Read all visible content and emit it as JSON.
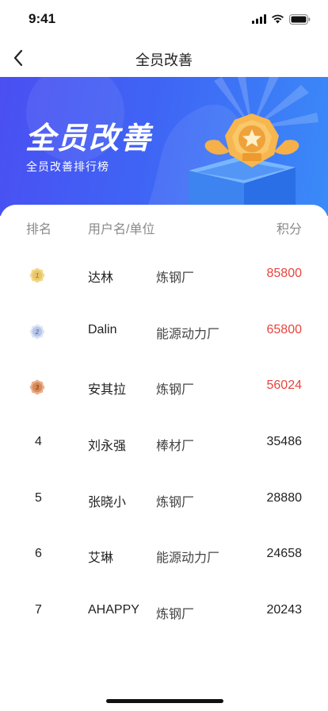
{
  "status_bar": {
    "time": "9:41"
  },
  "nav": {
    "title": "全员改善"
  },
  "banner": {
    "title": "全员改善",
    "subtitle": "全员改善排行榜"
  },
  "table": {
    "headers": {
      "rank": "排名",
      "user": "用户名/单位",
      "points": "积分"
    },
    "rows": [
      {
        "rank": "1",
        "medal": "gold",
        "name": "达林",
        "unit": "炼钢厂",
        "points": "85800"
      },
      {
        "rank": "2",
        "medal": "silver",
        "name": "Dalin",
        "unit": "能源动力厂",
        "points": "65800"
      },
      {
        "rank": "3",
        "medal": "bronze",
        "name": "安其拉",
        "unit": "炼钢厂",
        "points": "56024"
      },
      {
        "rank": "4",
        "medal": "",
        "name": "刘永强",
        "unit": "棒材厂",
        "points": "35486"
      },
      {
        "rank": "5",
        "medal": "",
        "name": "张晓小",
        "unit": "炼钢厂",
        "points": "28880"
      },
      {
        "rank": "6",
        "medal": "",
        "name": "艾琳",
        "unit": "能源动力厂",
        "points": "24658"
      },
      {
        "rank": "7",
        "medal": "",
        "name": "AHAPPY",
        "unit": "炼钢厂",
        "points": "20243"
      }
    ]
  },
  "colors": {
    "accent_red": "#e8443d",
    "banner_start": "#4a4ff2",
    "banner_end": "#3a8bf8",
    "gold": "#e8c66a",
    "silver": "#b8c6e8",
    "bronze": "#d98a5a"
  },
  "icons": {
    "back": "chevron-left-icon",
    "signal": "signal-bars-icon",
    "wifi": "wifi-icon",
    "battery": "battery-icon",
    "trophy": "trophy-badge-icon"
  }
}
